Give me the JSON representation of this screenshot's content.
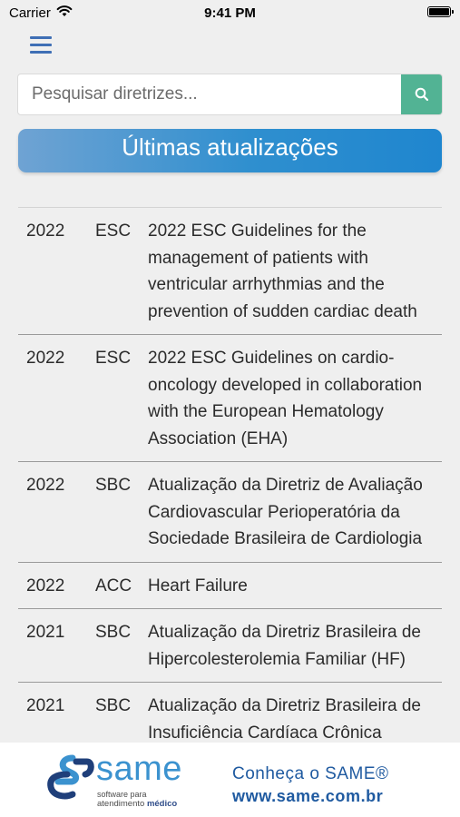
{
  "status": {
    "carrier": "Carrier",
    "time": "9:41 PM"
  },
  "search": {
    "placeholder": "Pesquisar diretrizes...",
    "value": ""
  },
  "banner": {
    "title": "Últimas atualizações"
  },
  "guidelines": [
    {
      "year": "2022",
      "org": "ESC",
      "title": "2022 ESC Guidelines for the management of patients with ventricular arrhythmias and the prevention of sudden cardiac death"
    },
    {
      "year": "2022",
      "org": "ESC",
      "title": "2022 ESC Guidelines on cardio-oncology developed in collaboration with the European Hematology Association (EHA)"
    },
    {
      "year": "2022",
      "org": "SBC",
      "title": "Atualização da Diretriz de Avaliação Cardiovascular Perioperatória da Sociedade Brasileira de Cardiologia"
    },
    {
      "year": "2022",
      "org": "ACC",
      "title": "Heart Failure"
    },
    {
      "year": "2021",
      "org": "SBC",
      "title": "Atualização da Diretriz Brasileira de Hipercolesterolemia Familiar (HF)"
    },
    {
      "year": "2021",
      "org": "SBC",
      "title": "Atualização da Diretriz Brasileira de Insuficiência Cardíaca Crônica"
    }
  ],
  "footer": {
    "logo_name": "same",
    "logo_sub_line1": "software para",
    "logo_sub_line2a": "atendimento",
    "logo_sub_line2b": "médico",
    "promo": "Conheça o SAME®",
    "url": "www.same.com.br"
  },
  "colors": {
    "accent": "#3f6fb5",
    "search_button": "#52b394",
    "banner_start": "#6fa3d3",
    "banner_end": "#1f86cf",
    "footer_text": "#1f5aa0"
  }
}
